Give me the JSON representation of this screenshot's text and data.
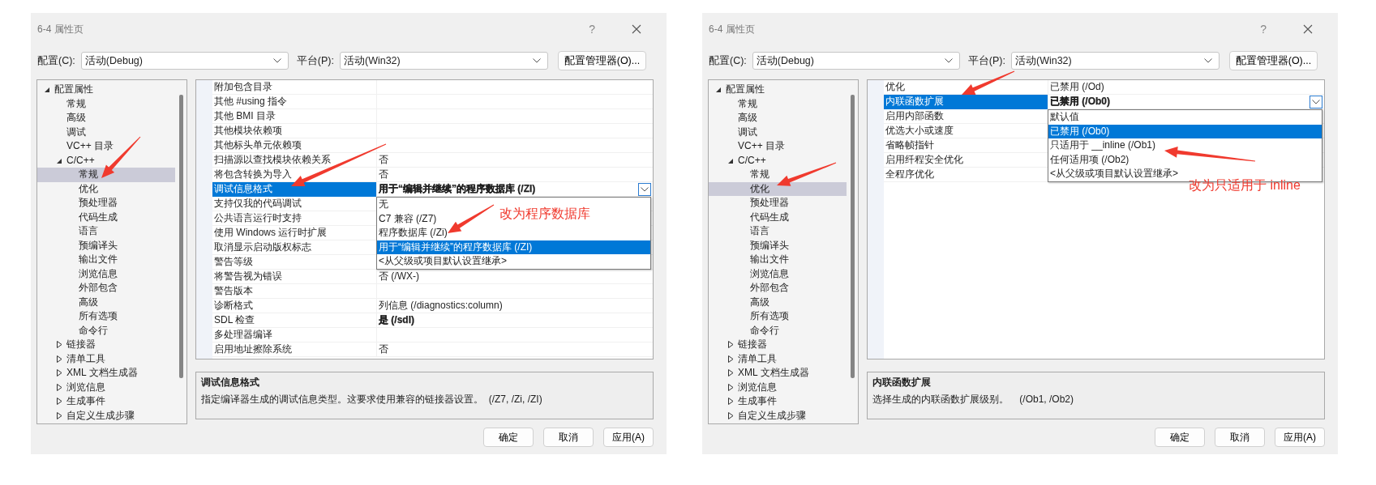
{
  "dialogs": [
    {
      "title": "6-4 属性页",
      "help": "?",
      "config_label": "配置(C):",
      "config_value": "活动(Debug)",
      "platform_label": "平台(P):",
      "platform_value": "活动(Win32)",
      "manager_button": "配置管理器(O)...",
      "tree": [
        {
          "label": "配置属性",
          "kind": "group",
          "expanded": true,
          "selected": false,
          "children": [
            {
              "label": "常规",
              "kind": "page",
              "selected": false
            },
            {
              "label": "高级",
              "kind": "page",
              "selected": false
            },
            {
              "label": "调试",
              "kind": "page",
              "selected": false
            },
            {
              "label": "VC++ 目录",
              "kind": "page",
              "selected": false
            },
            {
              "label": "C/C++",
              "kind": "group",
              "expanded": true,
              "selected": false,
              "children": [
                {
                  "label": "常规",
                  "kind": "page",
                  "selected": true
                },
                {
                  "label": "优化",
                  "kind": "page",
                  "selected": false
                },
                {
                  "label": "预处理器",
                  "kind": "page",
                  "selected": false
                },
                {
                  "label": "代码生成",
                  "kind": "page",
                  "selected": false
                },
                {
                  "label": "语言",
                  "kind": "page",
                  "selected": false
                },
                {
                  "label": "预编译头",
                  "kind": "page",
                  "selected": false
                },
                {
                  "label": "输出文件",
                  "kind": "page",
                  "selected": false
                },
                {
                  "label": "浏览信息",
                  "kind": "page",
                  "selected": false
                },
                {
                  "label": "外部包含",
                  "kind": "page",
                  "selected": false
                },
                {
                  "label": "高级",
                  "kind": "page",
                  "selected": false
                },
                {
                  "label": "所有选项",
                  "kind": "page",
                  "selected": false
                },
                {
                  "label": "命令行",
                  "kind": "page",
                  "selected": false
                }
              ]
            },
            {
              "label": "链接器",
              "kind": "group",
              "expanded": false,
              "selected": false
            },
            {
              "label": "清单工具",
              "kind": "group",
              "expanded": false,
              "selected": false
            },
            {
              "label": "XML 文档生成器",
              "kind": "group",
              "expanded": false,
              "selected": false
            },
            {
              "label": "浏览信息",
              "kind": "group",
              "expanded": false,
              "selected": false
            },
            {
              "label": "生成事件",
              "kind": "group",
              "expanded": false,
              "selected": false
            },
            {
              "label": "自定义生成步骤",
              "kind": "group",
              "expanded": false,
              "selected": false
            }
          ]
        }
      ],
      "properties": [
        {
          "name": "附加包含目录",
          "selected": false
        },
        {
          "name": "其他 #using 指令",
          "selected": false
        },
        {
          "name": "其他 BMI 目录",
          "selected": false
        },
        {
          "name": "其他模块依赖项",
          "selected": false
        },
        {
          "name": "其他标头单元依赖项",
          "selected": false
        },
        {
          "name": "扫描源以查找模块依赖关系",
          "value": "否",
          "selected": false,
          "modified": false
        },
        {
          "name": "将包含转换为导入",
          "value": "否",
          "selected": false,
          "modified": false
        },
        {
          "name": "调试信息格式",
          "value": "用于“编辑并继续”的程序数据库 (/ZI)",
          "selected": true,
          "modified": true
        },
        {
          "name": "支持仅我的代码调试",
          "selected": false
        },
        {
          "name": "公共语言运行时支持",
          "selected": false
        },
        {
          "name": "使用 Windows 运行时扩展",
          "selected": false
        },
        {
          "name": "取消显示启动版权标志",
          "selected": false
        },
        {
          "name": "警告等级",
          "selected": false
        },
        {
          "name": "将警告视为错误",
          "value": "否 (/WX-)",
          "selected": false,
          "modified": false
        },
        {
          "name": "警告版本",
          "selected": false
        },
        {
          "name": "诊断格式",
          "value": "列信息 (/diagnostics:column)",
          "selected": false,
          "modified": false
        },
        {
          "name": "SDL 检查",
          "value": "是 (/sdl)",
          "selected": false,
          "modified": true
        },
        {
          "name": "多处理器编译",
          "selected": false
        },
        {
          "name": "启用地址擦除系统",
          "value": "否",
          "selected": false,
          "modified": false
        }
      ],
      "dropdown": [
        {
          "label": "无",
          "selected": false
        },
        {
          "label": "C7 兼容 (/Z7)",
          "selected": false
        },
        {
          "label": "程序数据库 (/Zi)",
          "selected": false
        },
        {
          "label": "用于“编辑并继续”的程序数据库 (/ZI)",
          "selected": true
        },
        {
          "label": "<从父级或项目默认设置继承>",
          "selected": false
        }
      ],
      "description": {
        "title": "调试信息格式",
        "text": "指定编译器生成的调试信息类型。这要求使用兼容的链接器设置。  (/Z7, /Zi, /ZI)"
      },
      "buttons": [
        "确定",
        "取消",
        "应用(A)"
      ],
      "annotation": "改为程序数据库"
    },
    {
      "title": "6-4 属性页",
      "help": "?",
      "config_label": "配置(C):",
      "config_value": "活动(Debug)",
      "platform_label": "平台(P):",
      "platform_value": "活动(Win32)",
      "manager_button": "配置管理器(O)...",
      "tree": [
        {
          "label": "配置属性",
          "kind": "group",
          "expanded": true,
          "selected": false,
          "children": [
            {
              "label": "常规",
              "kind": "page",
              "selected": false
            },
            {
              "label": "高级",
              "kind": "page",
              "selected": false
            },
            {
              "label": "调试",
              "kind": "page",
              "selected": false
            },
            {
              "label": "VC++ 目录",
              "kind": "page",
              "selected": false
            },
            {
              "label": "C/C++",
              "kind": "group",
              "expanded": true,
              "selected": false,
              "children": [
                {
                  "label": "常规",
                  "kind": "page",
                  "selected": false
                },
                {
                  "label": "优化",
                  "kind": "page",
                  "selected": true
                },
                {
                  "label": "预处理器",
                  "kind": "page",
                  "selected": false
                },
                {
                  "label": "代码生成",
                  "kind": "page",
                  "selected": false
                },
                {
                  "label": "语言",
                  "kind": "page",
                  "selected": false
                },
                {
                  "label": "预编译头",
                  "kind": "page",
                  "selected": false
                },
                {
                  "label": "输出文件",
                  "kind": "page",
                  "selected": false
                },
                {
                  "label": "浏览信息",
                  "kind": "page",
                  "selected": false
                },
                {
                  "label": "外部包含",
                  "kind": "page",
                  "selected": false
                },
                {
                  "label": "高级",
                  "kind": "page",
                  "selected": false
                },
                {
                  "label": "所有选项",
                  "kind": "page",
                  "selected": false
                },
                {
                  "label": "命令行",
                  "kind": "page",
                  "selected": false
                }
              ]
            },
            {
              "label": "链接器",
              "kind": "group",
              "expanded": false,
              "selected": false
            },
            {
              "label": "清单工具",
              "kind": "group",
              "expanded": false,
              "selected": false
            },
            {
              "label": "XML 文档生成器",
              "kind": "group",
              "expanded": false,
              "selected": false
            },
            {
              "label": "浏览信息",
              "kind": "group",
              "expanded": false,
              "selected": false
            },
            {
              "label": "生成事件",
              "kind": "group",
              "expanded": false,
              "selected": false
            },
            {
              "label": "自定义生成步骤",
              "kind": "group",
              "expanded": false,
              "selected": false
            }
          ]
        }
      ],
      "properties": [
        {
          "name": "优化",
          "value": "已禁用 (/Od)",
          "selected": false,
          "modified": false
        },
        {
          "name": "内联函数扩展",
          "value": "已禁用 (/Ob0)",
          "selected": true,
          "modified": true
        },
        {
          "name": "启用内部函数",
          "selected": false
        },
        {
          "name": "优选大小或速度",
          "selected": false
        },
        {
          "name": "省略帧指针",
          "selected": false
        },
        {
          "name": "启用纤程安全优化",
          "selected": false
        },
        {
          "name": "全程序优化",
          "selected": false
        }
      ],
      "dropdown": [
        {
          "label": "默认值",
          "selected": false
        },
        {
          "label": "已禁用 (/Ob0)",
          "selected": true
        },
        {
          "label": "只适用于 __inline (/Ob1)",
          "selected": false
        },
        {
          "label": "任何适用项 (/Ob2)",
          "selected": false
        },
        {
          "label": "<从父级或项目默认设置继承>",
          "selected": false
        }
      ],
      "description": {
        "title": "内联函数扩展",
        "text": "选择生成的内联函数扩展级别。    (/Ob1, /Ob2)"
      },
      "buttons": [
        "确定",
        "取消",
        "应用(A)"
      ],
      "annotation": "改为只适用于 inline"
    }
  ]
}
